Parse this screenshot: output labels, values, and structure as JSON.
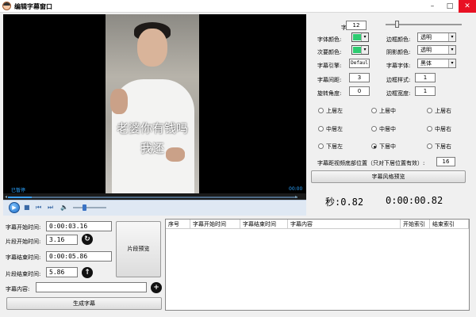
{
  "window": {
    "title": "编辑字幕窗口",
    "minimize": "–",
    "maximize": "□",
    "close": "✕"
  },
  "video": {
    "subtitle_line1": "老婆你有钱吗",
    "subtitle_line2": "我还",
    "status": "已暂停",
    "time_code": "00:00"
  },
  "settings": {
    "font_size_label": "字体大小:",
    "font_size_value": "12",
    "font_size_slider": 0.12,
    "font_color_label": "字体颜色:",
    "secondary_color_label": "次要颜色:",
    "border_color_label": "边框颜色:",
    "border_color_value": "透明",
    "shadow_color_label": "阴影颜色:",
    "shadow_color_value": "透明",
    "subtitle_font_label": "字幕字体:",
    "subtitle_font_value": "黑体",
    "subtitle_engine_label": "字幕引擎:",
    "subtitle_engine_value": "Defaul",
    "subtitle_spacing_label": "字幕间距:",
    "subtitle_spacing_value": "3",
    "border_style_label": "边框样式:",
    "border_style_value": "1",
    "rotation_label": "旋转角度:",
    "rotation_value": "0",
    "border_width_label": "边框宽度:",
    "border_width_value": "1",
    "accent_color": "#2ecc71"
  },
  "positions": {
    "top_left": "上居左",
    "top_center": "上居中",
    "top_right": "上居右",
    "mid_left": "中居左",
    "mid_center": "中居中",
    "mid_right": "中居右",
    "bottom_left": "下居左",
    "bottom_center": "下居中",
    "bottom_right": "下居右",
    "selected": "bottom_center"
  },
  "bottom_offset": {
    "label": "字幕距视频底部位置（只对下居位置有效）:",
    "value": "16"
  },
  "preview_style_button": "字幕风格预览",
  "timers": {
    "seconds": "秒:0.82",
    "full": "0:00:00.82"
  },
  "form": {
    "start_time_label": "字幕开始时间:",
    "start_time_value": "0:00:03.16",
    "clip_start_label": "片段开始时间:",
    "clip_start_value": "3.16",
    "end_time_label": "字幕结束时间:",
    "end_time_value": "0:00:05.86",
    "clip_end_label": "片段结束时间:",
    "clip_end_value": "5.86",
    "content_label": "字幕内容:",
    "content_value": "",
    "clip_preview_button": "片段预览",
    "generate_button": "生成字幕"
  },
  "table": {
    "columns": [
      "序号",
      "字幕开始时间",
      "字幕结束时间",
      "字幕内容",
      "开始索引",
      "结束索引"
    ]
  }
}
